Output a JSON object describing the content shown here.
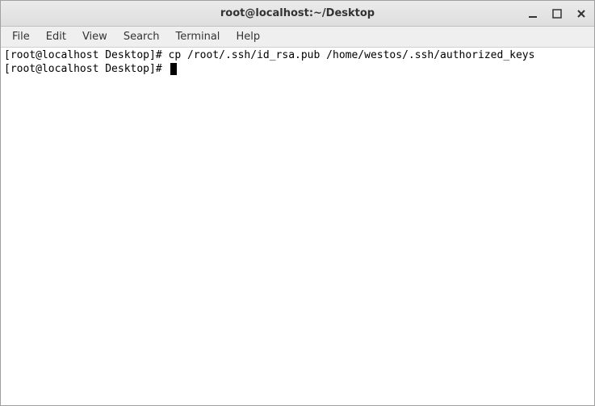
{
  "window": {
    "title": "root@localhost:~/Desktop"
  },
  "menubar": {
    "items": [
      "File",
      "Edit",
      "View",
      "Search",
      "Terminal",
      "Help"
    ]
  },
  "terminal": {
    "line1_prompt": "[root@localhost Desktop]# ",
    "line1_command": "cp /root/.ssh/id_rsa.pub /home/westos/.ssh/authorized_keys",
    "line2_prompt": "[root@localhost Desktop]# "
  }
}
